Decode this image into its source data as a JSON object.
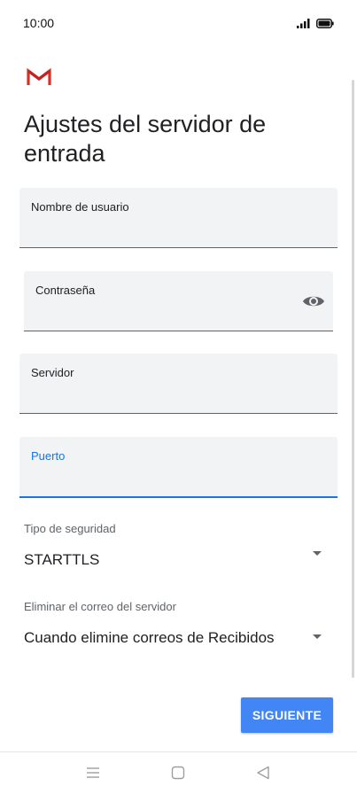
{
  "status_bar": {
    "time": "10:00",
    "icons": [
      "signal-icon",
      "battery-icon"
    ]
  },
  "header": {
    "logo_icon": "gmail-logo-icon",
    "title": "Ajustes del servidor de entrada"
  },
  "form": {
    "username": {
      "label": "Nombre de usuario",
      "value": ""
    },
    "password": {
      "label": "Contraseña",
      "value": "",
      "toggle_icon": "eye-icon"
    },
    "server": {
      "label": "Servidor",
      "value": ""
    },
    "port": {
      "label": "Puerto",
      "value": "",
      "focused": true
    }
  },
  "security": {
    "label": "Tipo de seguridad",
    "selected": "STARTTLS"
  },
  "delete_mail": {
    "label": "Eliminar el correo del servidor",
    "selected": "Cuando elimine correos de Recibidos"
  },
  "actions": {
    "next_label": "SIGUIENTE"
  },
  "nav_bar": {
    "icons": [
      "menu-icon",
      "home-icon",
      "back-icon"
    ]
  },
  "colors": {
    "accent": "#1a73e8",
    "button": "#4285f4",
    "field_bg": "#f1f3f4",
    "gmail_red": "#d93025"
  }
}
